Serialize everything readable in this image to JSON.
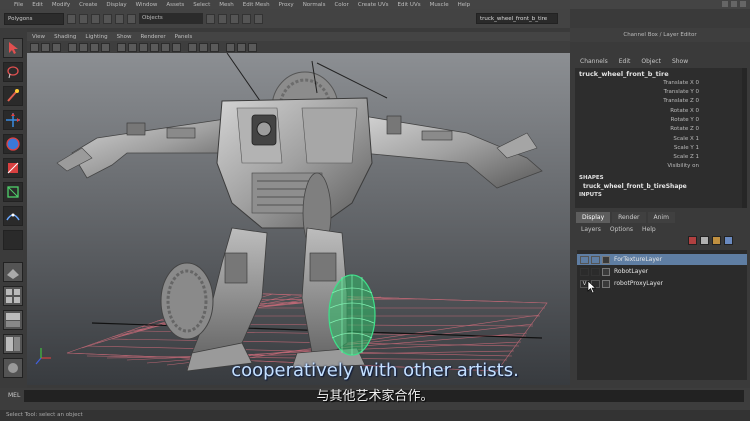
{
  "app": {
    "menus": [
      "File",
      "Edit",
      "Modify",
      "Create",
      "Display",
      "Window",
      "Assets",
      "Select",
      "Mesh",
      "Edit Mesh",
      "Proxy",
      "Normals",
      "Color",
      "Create UVs",
      "Edit UVs",
      "Muscle",
      "Help"
    ]
  },
  "status_line": {
    "mode": "Polygons",
    "object_field": "Objects",
    "selection_name": "truck_wheel_front_b_tire"
  },
  "viewport": {
    "menus": [
      "View",
      "Shading",
      "Lighting",
      "Show",
      "Renderer",
      "Panels"
    ]
  },
  "channel_box": {
    "header": "Channel Box / Layer Editor",
    "menus": [
      "Channels",
      "Edit",
      "Object",
      "Show"
    ],
    "object_name": "truck_wheel_front_b_tire",
    "attributes": [
      {
        "label": "Translate X",
        "value": "0"
      },
      {
        "label": "Translate Y",
        "value": "0"
      },
      {
        "label": "Translate Z",
        "value": "0"
      },
      {
        "label": "Rotate X",
        "value": "0"
      },
      {
        "label": "Rotate Y",
        "value": "0"
      },
      {
        "label": "Rotate Z",
        "value": "0"
      },
      {
        "label": "Scale X",
        "value": "1"
      },
      {
        "label": "Scale Y",
        "value": "1"
      },
      {
        "label": "Scale Z",
        "value": "1"
      },
      {
        "label": "Visibility",
        "value": "on"
      }
    ],
    "shapes_label": "SHAPES",
    "shape_name": "truck_wheel_front_b_tireShape",
    "inputs_label": "INPUTS"
  },
  "layer_editor": {
    "tabs": [
      "Display",
      "Render",
      "Anim"
    ],
    "menus": [
      "Layers",
      "Options",
      "Help"
    ],
    "layers": [
      {
        "name": "ForTextureLayer",
        "visible": "",
        "active": true
      },
      {
        "name": "RobotLayer",
        "visible": "",
        "active": false
      },
      {
        "name": "robotProxyLayer",
        "visible": "V",
        "active": false
      }
    ]
  },
  "command_line": {
    "label": "MEL",
    "help_text": "Select Tool: select an object"
  },
  "subtitles": {
    "english": "cooperatively with other artists.",
    "chinese": "与其他艺术家合作。"
  },
  "colors": {
    "active_layer": "#5f7ea3",
    "proxy_wire": "#3ee08a",
    "grid": "#c86a78",
    "viewport_bg_top": "#8a8d91",
    "viewport_bg_bottom": "#3a3d41"
  }
}
